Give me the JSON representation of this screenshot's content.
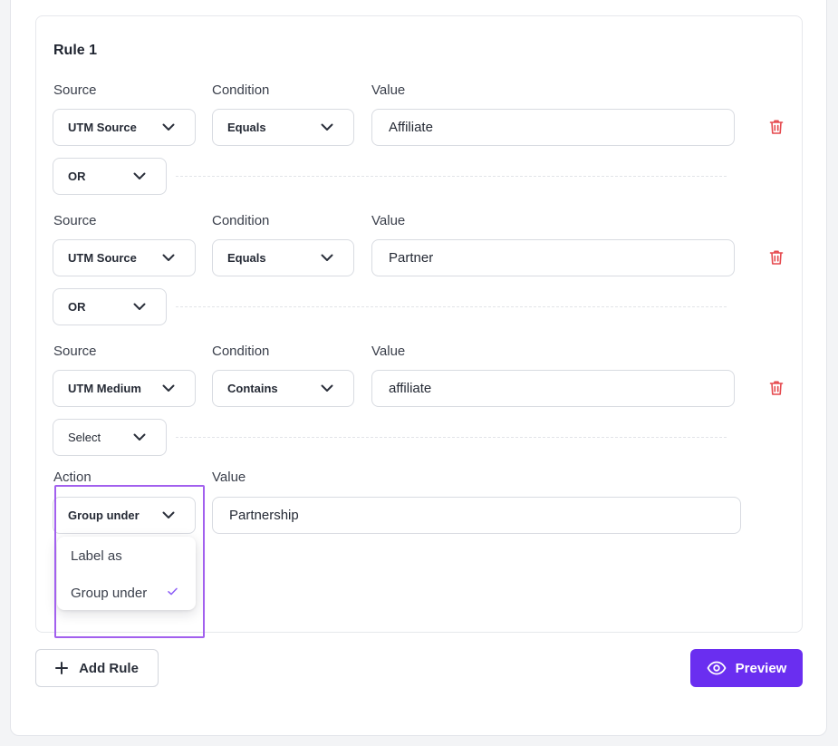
{
  "rule": {
    "title": "Rule 1",
    "conditions": [
      {
        "source_label": "Source",
        "condition_label": "Condition",
        "value_label": "Value",
        "source": "UTM Source",
        "condition": "Equals",
        "value": "Affiliate",
        "connector": "OR"
      },
      {
        "source_label": "Source",
        "condition_label": "Condition",
        "value_label": "Value",
        "source": "UTM Source",
        "condition": "Equals",
        "value": "Partner",
        "connector": "OR"
      },
      {
        "source_label": "Source",
        "condition_label": "Condition",
        "value_label": "Value",
        "source": "UTM Medium",
        "condition": "Contains",
        "value": "affiliate",
        "connector": "Select"
      }
    ],
    "action": {
      "action_label": "Action",
      "value_label": "Value",
      "selected": "Group under",
      "value": "Partnership",
      "options": [
        "Label as",
        "Group under"
      ]
    }
  },
  "buttons": {
    "add_rule": "Add Rule",
    "preview": "Preview"
  },
  "colors": {
    "accent": "#6a2ef0",
    "delete": "#e5484d",
    "highlight": "#a260ee"
  },
  "icons": {
    "delete": "trash-icon",
    "dropdown": "chevron-down-icon",
    "add": "plus-icon",
    "preview": "eye-icon",
    "selected": "check-icon"
  }
}
